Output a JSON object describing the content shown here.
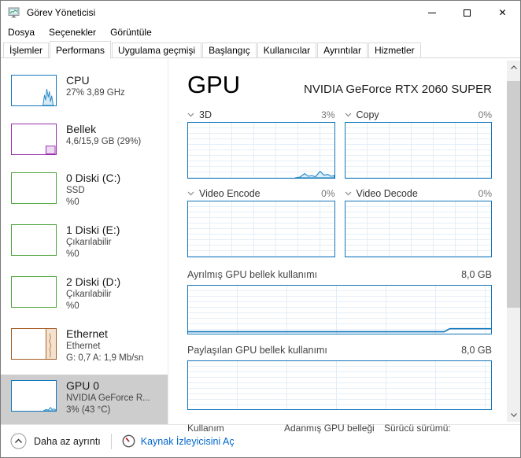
{
  "window": {
    "title": "Görev Yöneticisi",
    "close_glyph": "✕"
  },
  "menu": {
    "items": [
      "Dosya",
      "Seçenekler",
      "Görüntüle"
    ]
  },
  "tabs": [
    {
      "label": "İşlemler",
      "active": false
    },
    {
      "label": "Performans",
      "active": true
    },
    {
      "label": "Uygulama geçmişi",
      "active": false
    },
    {
      "label": "Başlangıç",
      "active": false
    },
    {
      "label": "Kullanıcılar",
      "active": false
    },
    {
      "label": "Ayrıntılar",
      "active": false
    },
    {
      "label": "Hizmetler",
      "active": false
    }
  ],
  "sidebar": {
    "items": [
      {
        "title": "CPU",
        "lines": [
          "27% 3,89 GHz"
        ],
        "color": "#1176bb"
      },
      {
        "title": "Bellek",
        "lines": [
          "4,6/15,9 GB (29%)"
        ],
        "color": "#9b2fae"
      },
      {
        "title": "0 Diski (C:)",
        "lines": [
          "SSD",
          "%0"
        ],
        "color": "#4aa338"
      },
      {
        "title": "1 Diski (E:)",
        "lines": [
          "Çıkarılabilir",
          "%0"
        ],
        "color": "#4aa338"
      },
      {
        "title": "2 Diski (D:)",
        "lines": [
          "Çıkarılabilir",
          "%0"
        ],
        "color": "#4aa338"
      },
      {
        "title": "Ethernet",
        "lines": [
          "Ethernet",
          "G: 0,7 A: 1,9 Mb/sn"
        ],
        "color": "#a35a21"
      },
      {
        "title": "GPU 0",
        "lines": [
          "NVIDIA GeForce R...",
          "3% (43 °C)"
        ],
        "color": "#1176bb",
        "selected": true
      }
    ]
  },
  "gpu_panel": {
    "title": "GPU",
    "subtitle": "NVIDIA GeForce RTX 2060 SUPER",
    "engine_charts": [
      {
        "label": "3D",
        "value": "3%"
      },
      {
        "label": "Copy",
        "value": "0%"
      },
      {
        "label": "Video Encode",
        "value": "0%"
      },
      {
        "label": "Video Decode",
        "value": "0%"
      }
    ],
    "memory_charts": [
      {
        "label": "Ayrılmış GPU bellek kullanımı",
        "value": "8,0 GB"
      },
      {
        "label": "Paylaşılan GPU bellek kullanımı",
        "value": "8,0 GB"
      }
    ],
    "stats_labels": [
      "Kullanım",
      "Adanmış GPU belleği",
      "Sürücü sürümü:"
    ]
  },
  "footer": {
    "details_toggle": "Daha az ayrıntı",
    "resource_link": "Kaynak İzleyicisini Aç"
  },
  "icons": {
    "app": "task-manager-monitor-icon",
    "minimize": "minimize-icon",
    "maximize": "maximize-icon",
    "close": "close-icon",
    "section": "chevron-down-icon",
    "footer_toggle": "chevron-up-circle-icon",
    "resource": "resource-monitor-gauge-icon"
  },
  "colors": {
    "accent_blue": "#1176bb",
    "memory_purple": "#9b2fae",
    "disk_green": "#4aa338",
    "ethernet_brown": "#a35a21",
    "selected_bg": "#cdcdcd",
    "link_blue": "#0066cc",
    "percent_gray": "#767676"
  }
}
